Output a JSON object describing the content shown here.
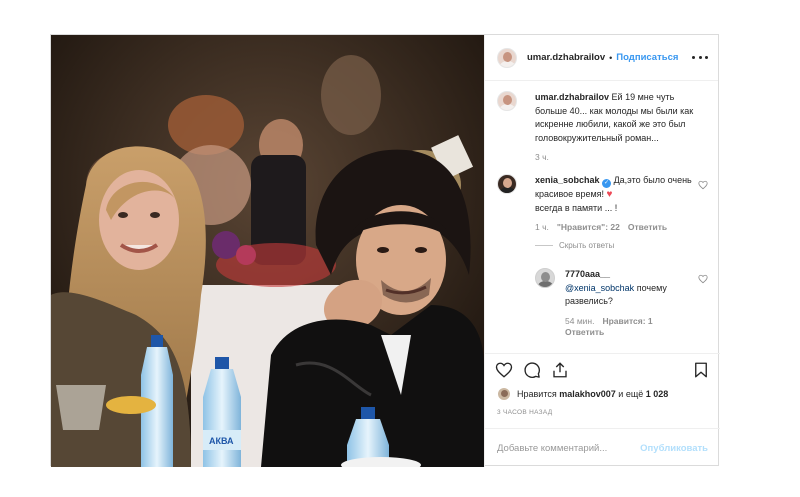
{
  "post": {
    "username": "umar.dzhabrailov",
    "follow_label": "Подписаться",
    "caption": {
      "username": "umar.dzhabrailov",
      "text": "Ей 19 мне чуть больше 40... как молоды мы были как искренне любили, какой же это был головокружительный роман...",
      "time": "3 ч."
    },
    "comments": [
      {
        "username": "xenia_sobchak",
        "text": "Да,это было очень красивое время!",
        "text2": "всегда в памяти ... !",
        "time": "1 ч.",
        "likes": "\"Нравится\": 22",
        "reply_label": "Ответить",
        "hide_label": "Скрыть ответы"
      },
      {
        "username": "7770aaa__",
        "mention": "@xenia_sobchak",
        "text": "почему развелись?",
        "time": "54 мин.",
        "likes": "Нравится: 1",
        "reply_label": "Ответить"
      }
    ],
    "likes_prefix": "Нравится",
    "likes_user": "malakhov007",
    "likes_suffix": "и ещё",
    "likes_count": "1 028",
    "timestamp": "3 часов назад",
    "add_comment_placeholder": "Добавьте комментарий...",
    "publish_label": "Опубликовать",
    "bottle_text": "АКВА"
  }
}
